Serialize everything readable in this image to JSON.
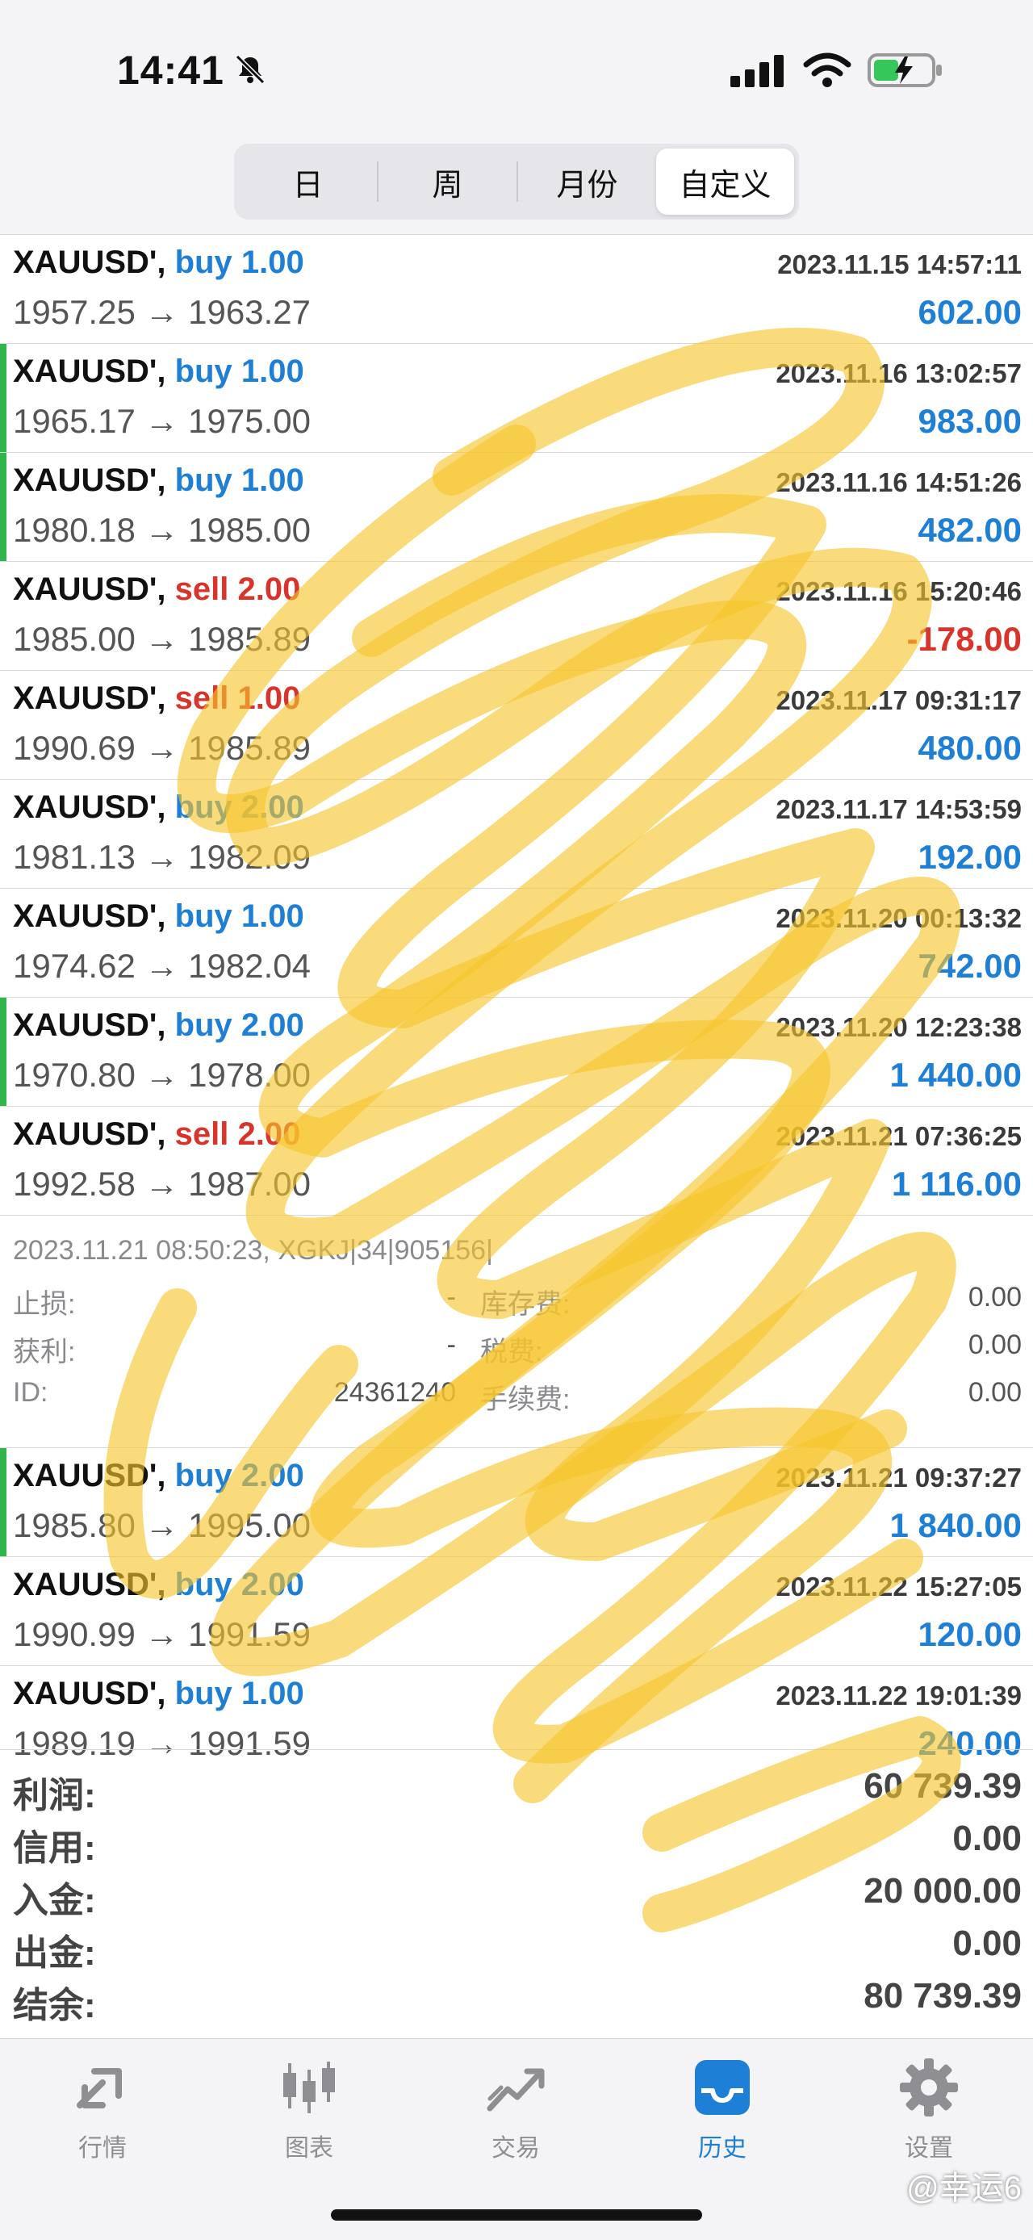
{
  "status": {
    "time": "14:41"
  },
  "period_tabs": [
    "日",
    "周",
    "月份",
    "自定义"
  ],
  "active_period": "自定义",
  "trades": [
    {
      "symbol": "XAUUSD'",
      "action": "buy",
      "lots": "1.00",
      "date": "2023.11.15 14:57:11",
      "open": "1957.25",
      "close": "1963.27",
      "profit": "602.00",
      "marker": false
    },
    {
      "symbol": "XAUUSD'",
      "action": "buy",
      "lots": "1.00",
      "date": "2023.11.16 13:02:57",
      "open": "1965.17",
      "close": "1975.00",
      "profit": "983.00",
      "marker": true
    },
    {
      "symbol": "XAUUSD'",
      "action": "buy",
      "lots": "1.00",
      "date": "2023.11.16 14:51:26",
      "open": "1980.18",
      "close": "1985.00",
      "profit": "482.00",
      "marker": true
    },
    {
      "symbol": "XAUUSD'",
      "action": "sell",
      "lots": "2.00",
      "date": "2023.11.16 15:20:46",
      "open": "1985.00",
      "close": "1985.89",
      "profit": "-178.00",
      "marker": false
    },
    {
      "symbol": "XAUUSD'",
      "action": "sell",
      "lots": "1.00",
      "date": "2023.11.17 09:31:17",
      "open": "1990.69",
      "close": "1985.89",
      "profit": "480.00",
      "marker": false
    },
    {
      "symbol": "XAUUSD'",
      "action": "buy",
      "lots": "2.00",
      "date": "2023.11.17 14:53:59",
      "open": "1981.13",
      "close": "1982.09",
      "profit": "192.00",
      "marker": false
    },
    {
      "symbol": "XAUUSD'",
      "action": "buy",
      "lots": "1.00",
      "date": "2023.11.20 00:13:32",
      "open": "1974.62",
      "close": "1982.04",
      "profit": "742.00",
      "marker": false
    },
    {
      "symbol": "XAUUSD'",
      "action": "buy",
      "lots": "2.00",
      "date": "2023.11.20 12:23:38",
      "open": "1970.80",
      "close": "1978.00",
      "profit": "1 440.00",
      "marker": true
    },
    {
      "symbol": "XAUUSD'",
      "action": "sell",
      "lots": "2.00",
      "date": "2023.11.21 07:36:25",
      "open": "1992.58",
      "close": "1987.00",
      "profit": "1 116.00",
      "marker": false
    }
  ],
  "detail": {
    "meta": "2023.11.21 08:50:23, XGKJ|34|905156|",
    "rows": [
      {
        "label": "止损:",
        "value": "-",
        "label2": "库存费:",
        "value2": "0.00"
      },
      {
        "label": "获利:",
        "value": "-",
        "label2": "税费:",
        "value2": "0.00"
      },
      {
        "label": "ID:",
        "value": "24361240",
        "label2": "手续费:",
        "value2": "0.00"
      }
    ]
  },
  "trades_after": [
    {
      "symbol": "XAUUSD'",
      "action": "buy",
      "lots": "2.00",
      "date": "2023.11.21 09:37:27",
      "open": "1985.80",
      "close": "1995.00",
      "profit": "1 840.00",
      "marker": true
    },
    {
      "symbol": "XAUUSD'",
      "action": "buy",
      "lots": "2.00",
      "date": "2023.11.22 15:27:05",
      "open": "1990.99",
      "close": "1991.59",
      "profit": "120.00",
      "marker": false
    },
    {
      "symbol": "XAUUSD'",
      "action": "buy",
      "lots": "1.00",
      "date": "2023.11.22 19:01:39",
      "open": "1989.19",
      "close": "1991.59",
      "profit": "240.00",
      "marker": false
    }
  ],
  "totals": [
    {
      "label": "利润:",
      "value": "60 739.39"
    },
    {
      "label": "信用:",
      "value": "0.00"
    },
    {
      "label": "入金:",
      "value": "20 000.00"
    },
    {
      "label": "出金:",
      "value": "0.00"
    },
    {
      "label": "结余:",
      "value": "80 739.39"
    }
  ],
  "tabbar": [
    {
      "label": "行情",
      "icon": "quotes-arrows-icon"
    },
    {
      "label": "图表",
      "icon": "candlestick-chart-icon"
    },
    {
      "label": "交易",
      "icon": "trade-chart-icon"
    },
    {
      "label": "历史",
      "icon": "history-inbox-icon",
      "active": true
    },
    {
      "label": "设置",
      "icon": "gear-icon"
    }
  ],
  "watermark": "@幸运6",
  "colors": {
    "buy": "#1e7fd6",
    "sell": "#d8342c",
    "marker": "#2fb54a",
    "accent": "#1e7fd6"
  }
}
